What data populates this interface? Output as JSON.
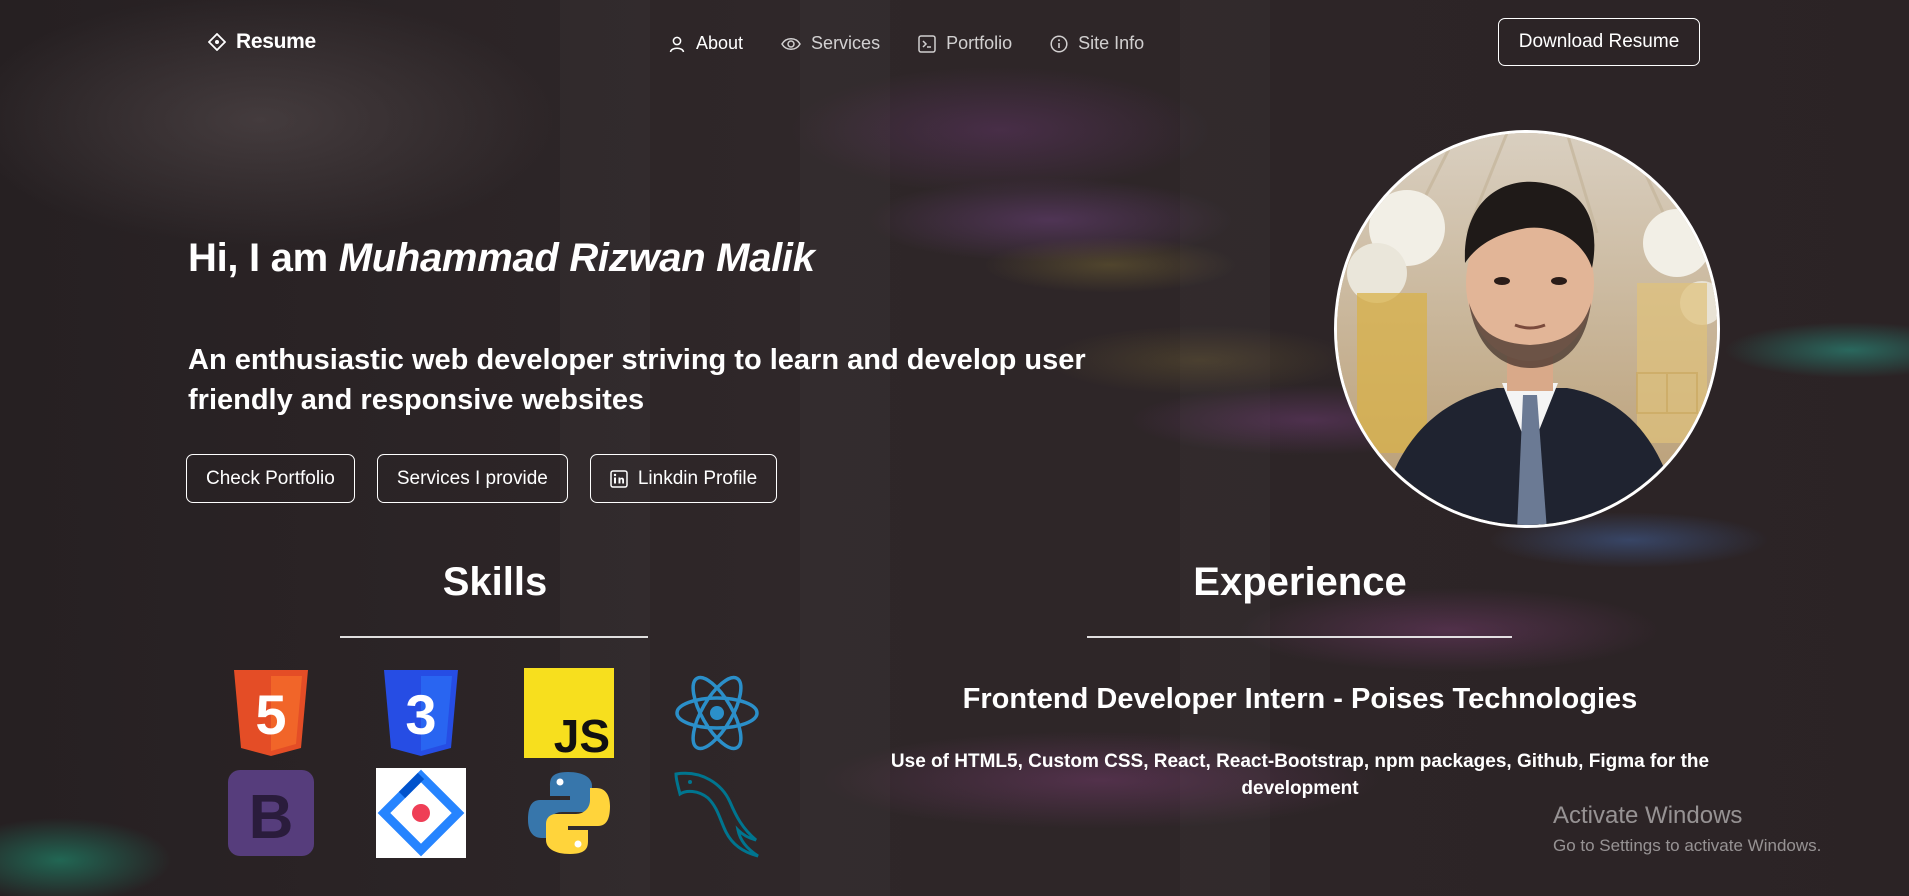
{
  "nav": {
    "brand": "Resume",
    "links": [
      {
        "label": "About",
        "icon": "person-icon"
      },
      {
        "label": "Services",
        "icon": "eye-icon"
      },
      {
        "label": "Portfolio",
        "icon": "terminal-icon"
      },
      {
        "label": "Site Info",
        "icon": "info-icon"
      }
    ],
    "download_label": "Download Resume"
  },
  "hero": {
    "greeting": "Hi, I am ",
    "name": "Muhammad Rizwan Malik",
    "tagline": "An enthusiastic web developer striving to learn and develop user friendly and responsive websites",
    "buttons": {
      "portfolio": "Check Portfolio",
      "services": "Services I provide",
      "linkedin": "Linkdin Profile"
    }
  },
  "skills": {
    "title": "Skills",
    "icons": [
      "html5-icon",
      "css3-icon",
      "javascript-icon",
      "react-icon",
      "bootstrap-icon",
      "jira-icon",
      "python-icon",
      "mysql-icon"
    ],
    "js_text": "JS",
    "html_num": "5",
    "css_num": "3",
    "bootstrap_letter": "B"
  },
  "experience": {
    "title": "Experience",
    "role": "Frontend Developer Intern - Poises Technologies",
    "description": "Use of HTML5, Custom CSS, React, React-Bootstrap, npm packages, Github, Figma for the development"
  },
  "watermark": {
    "line1": "Activate Windows",
    "line2": "Go to Settings to activate Windows."
  },
  "colors": {
    "background": "#2a2224",
    "html5": "#e44d26",
    "css3": "#264de4",
    "javascript": "#f7df1e",
    "react": "#61dafb",
    "bootstrap": "#563d7c",
    "jira": "#2684ff",
    "python_blue": "#3776ab",
    "python_yellow": "#ffd43b",
    "mysql": "#00758f"
  }
}
